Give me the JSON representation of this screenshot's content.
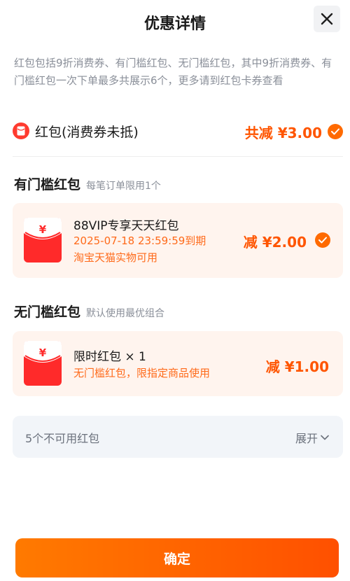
{
  "header": {
    "title": "优惠详情"
  },
  "intro": "红包包括9折消费券、有门槛红包、无门槛红包，其中9折消费券、有门槛红包一次下单最多共展示6个，更多请到红包卡券查看",
  "summary": {
    "label": "红包(消费券未抵)",
    "amount": "共减 ¥3.00"
  },
  "threshold_section": {
    "title": "有门槛红包",
    "subtitle": "每笔订单限用1个",
    "card": {
      "name": "88VIP专享天天红包",
      "expiry": "2025-07-18 23:59:59到期",
      "scope": "淘宝天猫实物可用",
      "amount": "减 ¥2.00"
    }
  },
  "nothreshold_section": {
    "title": "无门槛红包",
    "subtitle": "默认使用最优组合",
    "card": {
      "name": "限时红包 × 1",
      "desc": "无门槛红包，限指定商品使用",
      "amount": "减 ¥1.00"
    }
  },
  "unavailable": {
    "text": "5个不可用红包",
    "expand_label": "展开"
  },
  "confirm_label": "确定",
  "icons": {
    "close": "close-icon",
    "check": "check-icon",
    "envelope": "red-envelope-icon",
    "chevron": "chevron-down-icon"
  },
  "colors": {
    "accent": "#ff6a00",
    "price": "#ff5500",
    "card_bg": "#fff4ee",
    "envelope": "#ff2a2a"
  }
}
